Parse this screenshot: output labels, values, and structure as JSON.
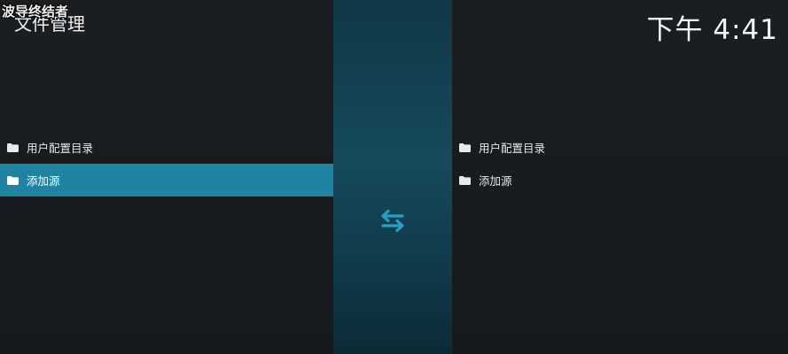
{
  "watermark": "波导终结者",
  "header": {
    "title": "文件管理",
    "clock": "下午 4:41"
  },
  "left_pane": {
    "items": [
      {
        "label": "用户配置目录",
        "icon": "folder-icon",
        "selected": false
      },
      {
        "label": "添加源",
        "icon": "folder-icon",
        "selected": true
      }
    ]
  },
  "right_pane": {
    "items": [
      {
        "label": "用户配置目录",
        "icon": "folder-icon",
        "selected": false
      },
      {
        "label": "添加源",
        "icon": "folder-icon",
        "selected": false
      }
    ]
  },
  "divider": {
    "icon": "swap-arrows-icon"
  },
  "colors": {
    "selection": "#1f84a2",
    "divider": "#154a5c",
    "swap_icon": "#2a9fc4",
    "background": "#16191c"
  }
}
